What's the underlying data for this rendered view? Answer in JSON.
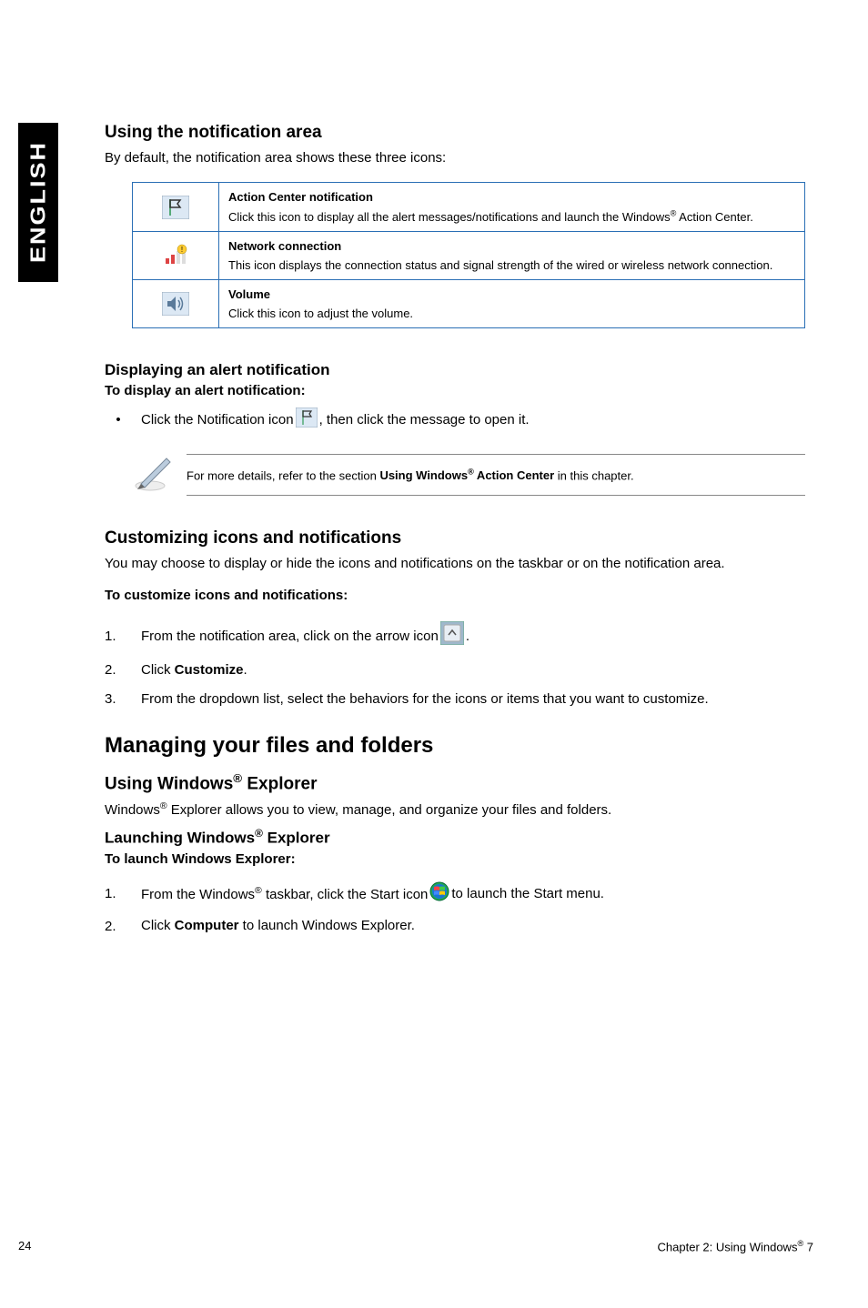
{
  "side_tab": "ENGLISH",
  "s1": {
    "heading": "Using the notification area",
    "intro": "By default, the notification area shows these three icons:",
    "rows": [
      {
        "title": "Action Center notification",
        "desc_pre": "Click this icon to display all the alert messages/notifications and launch the Windows",
        "desc_post": " Action Center."
      },
      {
        "title": "Network connection",
        "desc": "This icon displays the connection status and signal strength of the wired or wireless network connection."
      },
      {
        "title": "Volume",
        "desc": "Click this icon to adjust the volume."
      }
    ]
  },
  "s2": {
    "heading": "Displaying an alert notification",
    "sub": "To display an alert notification:",
    "line_pre": "Click the Notification icon ",
    "line_post": ", then click the message to open it.",
    "note_pre": "For more details, refer to the section ",
    "note_bold_pre": "Using Windows",
    "note_bold_post": " Action Center",
    "note_end": " in this chapter."
  },
  "s3": {
    "heading": "Customizing icons and notifications",
    "intro": "You may choose to display or hide the icons and notifications on the taskbar or on the notification area.",
    "sub": "To customize icons and notifications:",
    "item1_pre": "From the notification area, click on the arrow icon ",
    "item1_post": ".",
    "item2_pre": "Click ",
    "item2_bold": "Customize",
    "item2_post": ".",
    "item3": "From the dropdown list, select the behaviors for the icons or items that you want to customize."
  },
  "s4": {
    "big": "Managing your files and folders",
    "h_pre": "Using Windows",
    "h_post": " Explorer",
    "intro_pre": "Windows",
    "intro_post": " Explorer allows you to view, manage, and organize your files and folders.",
    "sub_pre": "Launching Windows",
    "sub_post": " Explorer",
    "bold": "To launch Windows Explorer:",
    "item1_pre": "From the Windows",
    "item1_mid": " taskbar, click the Start icon ",
    "item1_post": " to launch the Start menu.",
    "item2_pre": "Click ",
    "item2_bold": "Computer",
    "item2_post": " to launch Windows Explorer."
  },
  "footer": {
    "page": "24",
    "chapter_pre": "Chapter 2: Using Windows",
    "chapter_post": " 7"
  }
}
